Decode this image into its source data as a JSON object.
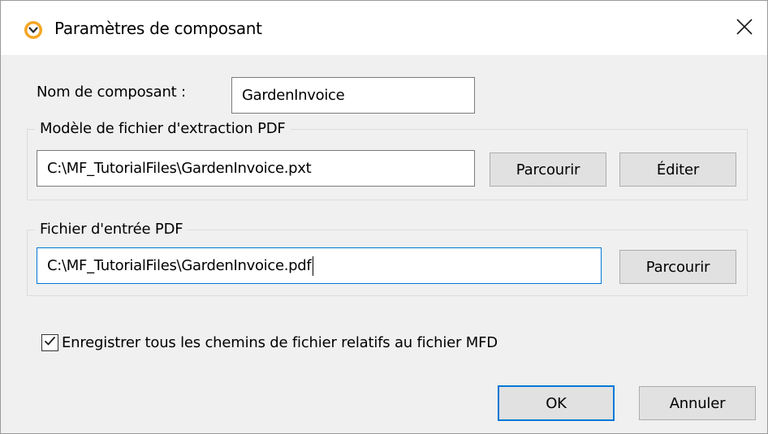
{
  "dialog": {
    "title": "Paramètres de composant",
    "icon": "altova-mapforce-icon",
    "close_icon": "close-icon"
  },
  "component_name": {
    "label": "Nom de composant :",
    "value": "GardenInvoice"
  },
  "template_group": {
    "legend": "Modèle de fichier d'extraction PDF",
    "path": "C:\\MF_TutorialFiles\\GardenInvoice.pxt",
    "browse_label": "Parcourir",
    "edit_label": "Éditer"
  },
  "input_group": {
    "legend": "Fichier d'entrée PDF",
    "path": "C:\\MF_TutorialFiles\\GardenInvoice.pdf",
    "browse_label": "Parcourir"
  },
  "relative_paths": {
    "label": "Enregistrer tous les chemins de fichier relatifs au fichier MFD",
    "checked": true
  },
  "footer": {
    "ok_label": "OK",
    "cancel_label": "Annuler"
  },
  "colors": {
    "accent": "#0078d7",
    "icon_orange": "#f5a623"
  }
}
